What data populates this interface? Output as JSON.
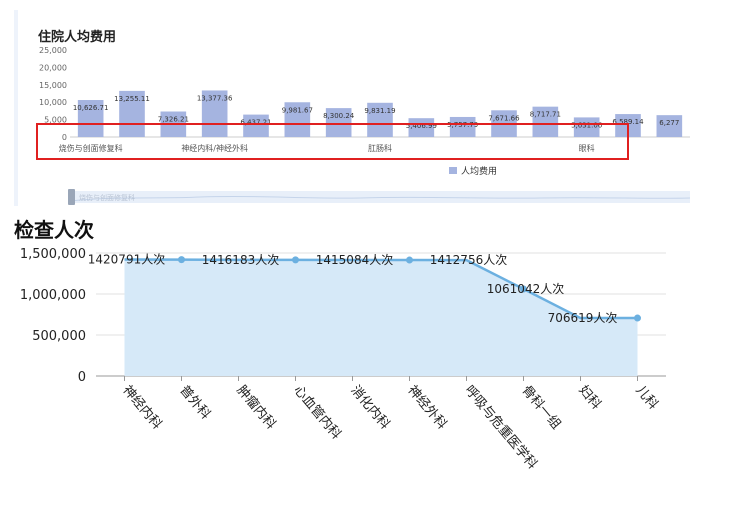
{
  "chart_data": [
    {
      "type": "bar",
      "title": "住院人均费用",
      "ylim": [
        0,
        25000
      ],
      "yticks": [
        "0",
        "5,000",
        "10,000",
        "15,000",
        "20,000",
        "25,000"
      ],
      "categories": [
        "烧伤与创面修复科",
        "",
        "",
        "神经内科/神经外科",
        "",
        "",
        "",
        "肛肠科",
        "",
        "",
        "",
        "",
        "眼科",
        "",
        ""
      ],
      "series": [
        {
          "name": "人均费用",
          "values": [
            10626.71,
            13255.11,
            7326.21,
            13377.36,
            6437.21,
            9981.67,
            8300.24,
            9831.19,
            5406.99,
            5757.79,
            7671.66,
            8717.71,
            5631.06,
            6589.14,
            6277
          ],
          "labels": [
            "10,626.71",
            "13,255.11",
            "7,326.21",
            "13,377.36",
            "6,437.21",
            "9,981.67",
            "8,300.24",
            "9,831.19",
            "5,406.99",
            "5,757.79",
            "7,671.66",
            "8,717.71",
            "5,631.06",
            "6,589.14",
            "6,277"
          ]
        }
      ],
      "legend": "bottom-center",
      "color": "#a5b4e0",
      "slider_label": "烧伤与创面修复科"
    },
    {
      "type": "area",
      "title": "检查人次",
      "ylim": [
        0,
        1500000
      ],
      "yticks": [
        "0",
        "500,000",
        "1,000,000",
        "1,500,000"
      ],
      "categories": [
        "神经内科",
        "普外科",
        "肿瘤内科",
        "心血管内科",
        "消化内科",
        "神经外科",
        "呼吸与危重医学科",
        "骨科一组",
        "妇科",
        "儿科"
      ],
      "series": [
        {
          "values": [
            1420791,
            1419500,
            1416183,
            1416000,
            1415084,
            1414000,
            1412756,
            1061042,
            706619,
            706619
          ],
          "labels": [
            "1420791人次",
            "",
            "1416183人次",
            "",
            "1415084人次",
            "",
            "1412756人次",
            "1061042人次",
            "706619人次",
            ""
          ]
        }
      ],
      "line_color": "#6cb0e0",
      "area_color": "#d6e9f8",
      "grid": true
    }
  ]
}
